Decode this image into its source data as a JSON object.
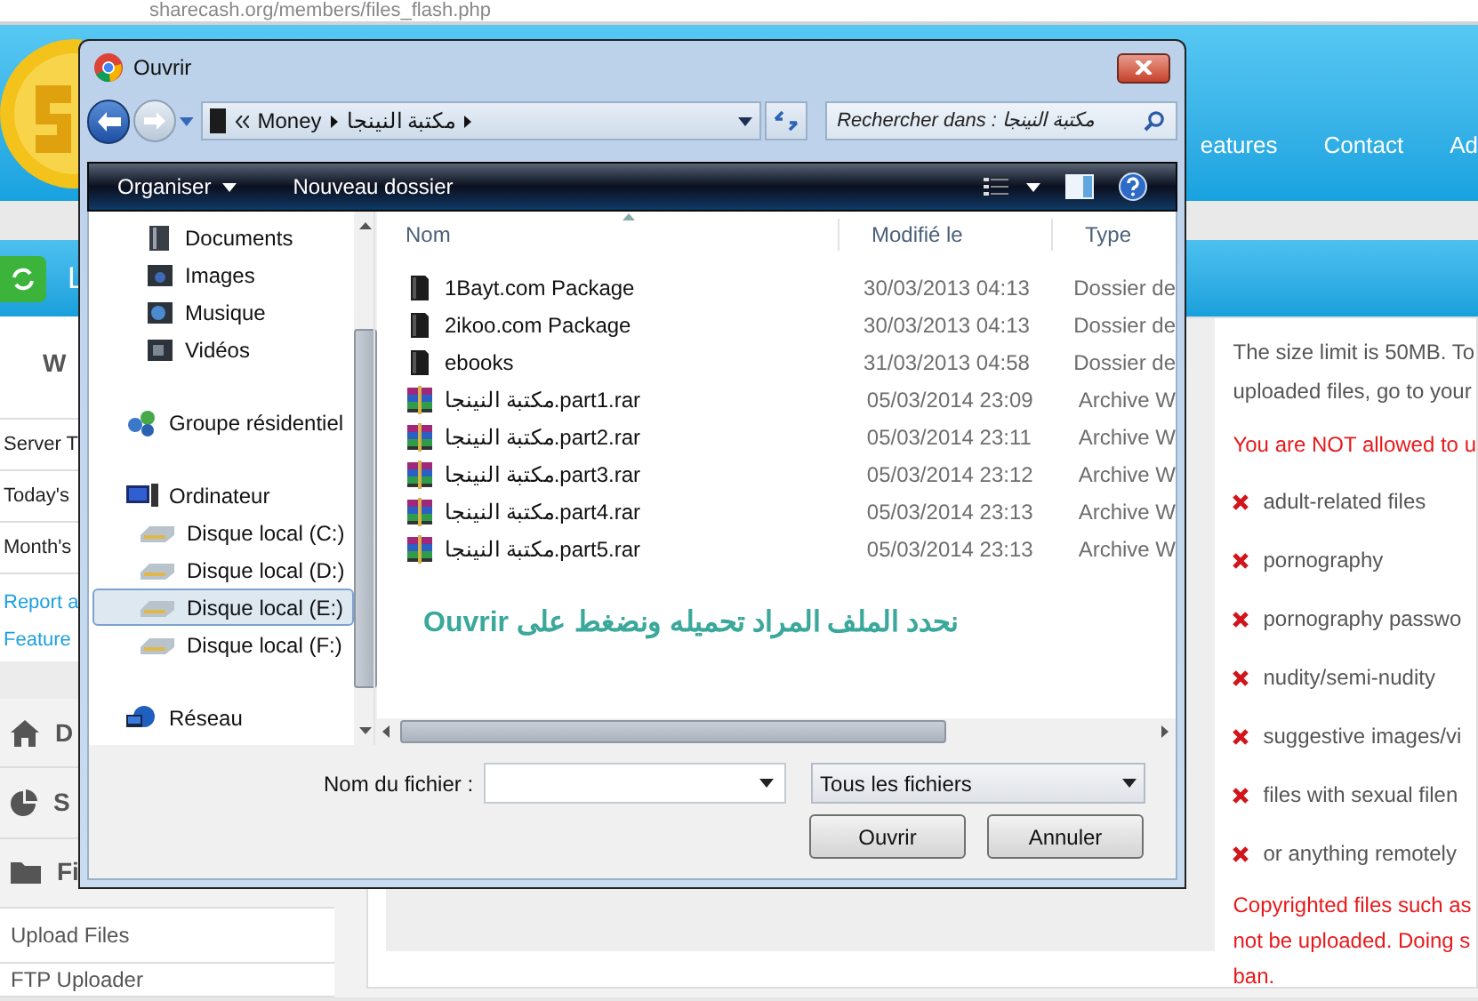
{
  "browser": {
    "url": "sharecash.org/members/files_flash.php"
  },
  "site_nav": [
    "eatures",
    "Contact",
    "Ad"
  ],
  "page_title": "L",
  "sidebar": {
    "heading": "W",
    "stats": [
      "Server T",
      "Today's",
      "Month's"
    ],
    "links": [
      "Report a",
      "Feature"
    ],
    "menu": [
      {
        "label": "D",
        "kind": "home"
      },
      {
        "label": "S",
        "kind": "stats"
      },
      {
        "label": "Fi",
        "kind": "files"
      }
    ],
    "submenu": [
      "Upload Files",
      "FTP Uploader"
    ]
  },
  "notice": {
    "intro": "The size limit is 50MB. To\nuploaded files, go to your",
    "warning": "You are NOT allowed to u",
    "banned": [
      "adult-related files",
      "pornography",
      "pornography passwo",
      "nudity/semi-nudity",
      "suggestive images/vi",
      "files with sexual filen",
      "or anything remotely"
    ],
    "copyright": "Copyrighted files such as\nnot be uploaded. Doing s\nban."
  },
  "dialog": {
    "title": "Ouvrir",
    "breadcrumb": [
      "Money",
      "مكتبة النينجا"
    ],
    "search": {
      "placeholder": "Rechercher dans : مكتبة النينجا"
    },
    "toolbar": [
      "Organiser",
      "Nouveau dossier"
    ],
    "nav_pane": [
      {
        "label": "Documents",
        "kind": "documents",
        "selected": false
      },
      {
        "label": "Images",
        "kind": "images",
        "selected": false
      },
      {
        "label": "Musique",
        "kind": "music",
        "selected": false
      },
      {
        "label": "Vidéos",
        "kind": "videos",
        "selected": false
      },
      {
        "label": "Groupe résidentiel",
        "kind": "homegroup",
        "selected": false
      },
      {
        "label": "Ordinateur",
        "kind": "computer",
        "selected": false,
        "children": [
          {
            "label": "Disque local (C:)",
            "kind": "drive",
            "selected": false
          },
          {
            "label": "Disque local (D:)",
            "kind": "drive",
            "selected": false
          },
          {
            "label": "Disque local (E:)",
            "kind": "drive",
            "selected": true
          },
          {
            "label": "Disque local (F:)",
            "kind": "drive",
            "selected": false
          }
        ]
      },
      {
        "label": "Réseau",
        "kind": "network",
        "selected": false
      }
    ],
    "columns": [
      "Nom",
      "Modifié le",
      "Type"
    ],
    "files": [
      {
        "name": "1Bayt.com Package",
        "modified": "30/03/2013 04:13",
        "type": "Dossier de",
        "kind": "folder"
      },
      {
        "name": "2ikoo.com Package",
        "modified": "30/03/2013 04:13",
        "type": "Dossier de",
        "kind": "folder"
      },
      {
        "name": "ebooks",
        "modified": "31/03/2013 04:58",
        "type": "Dossier de",
        "kind": "folder"
      },
      {
        "name": "مكتبة النينجا.part1.rar",
        "modified": "05/03/2014 23:09",
        "type": "Archive W",
        "kind": "archive"
      },
      {
        "name": "مكتبة النينجا.part2.rar",
        "modified": "05/03/2014 23:11",
        "type": "Archive W",
        "kind": "archive"
      },
      {
        "name": "مكتبة النينجا.part3.rar",
        "modified": "05/03/2014 23:12",
        "type": "Archive W",
        "kind": "archive"
      },
      {
        "name": "مكتبة النينجا.part4.rar",
        "modified": "05/03/2014 23:13",
        "type": "Archive W",
        "kind": "archive"
      },
      {
        "name": "مكتبة النينجا.part5.rar",
        "modified": "05/03/2014 23:13",
        "type": "Archive W",
        "kind": "archive"
      }
    ],
    "annotation": "نحدد الملف المراد تحميله ونضغط على Ouvrir",
    "filename": {
      "label": "Nom du fichier :"
    },
    "filter": "Tous les fichiers",
    "buttons": [
      "Ouvrir",
      "Annuler"
    ]
  }
}
